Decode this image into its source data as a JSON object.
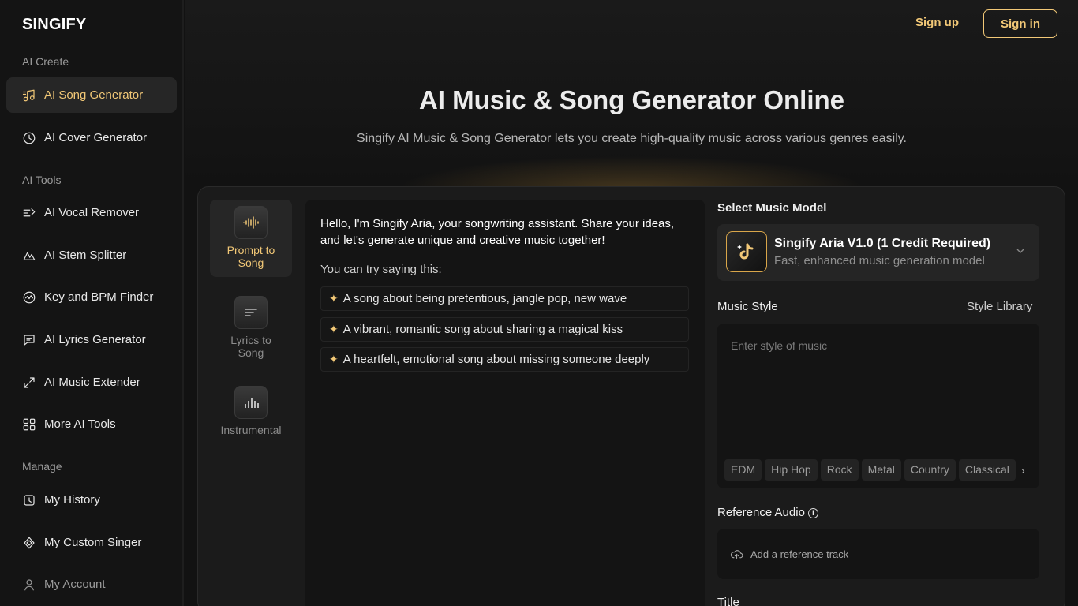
{
  "sidebar": {
    "logo": "SINGIFY",
    "sections": [
      {
        "label": "AI Create",
        "items": [
          {
            "label": "AI Song Generator",
            "icon": "music-note-icon",
            "active": true
          },
          {
            "label": "AI Cover Generator",
            "icon": "disc-icon"
          }
        ]
      },
      {
        "label": "AI Tools",
        "items": [
          {
            "label": "AI Vocal Remover",
            "icon": "vocal-split-icon"
          },
          {
            "label": "AI Stem Splitter",
            "icon": "stem-icon"
          },
          {
            "label": "Key and BPM Finder",
            "icon": "key-bpm-icon"
          },
          {
            "label": "AI Lyrics Generator",
            "icon": "lyrics-icon"
          },
          {
            "label": "AI Music Extender",
            "icon": "expand-icon"
          },
          {
            "label": "More AI Tools",
            "icon": "grid-icon"
          }
        ]
      },
      {
        "label": "Manage",
        "items": [
          {
            "label": "My History",
            "icon": "history-icon"
          },
          {
            "label": "My Custom Singer",
            "icon": "singer-icon"
          },
          {
            "label": "My Account",
            "icon": "user-icon"
          }
        ]
      }
    ]
  },
  "header": {
    "signup": "Sign up",
    "signin": "Sign in"
  },
  "hero": {
    "title": "AI Music & Song Generator Online",
    "subtitle": "Singify AI Music & Song Generator lets you create high-quality music across various genres easily."
  },
  "modes": [
    {
      "label": "Prompt to Song",
      "icon": "waveform-icon",
      "active": true
    },
    {
      "label": "Lyrics to Song",
      "icon": "lyrics-card-icon"
    },
    {
      "label": "Instrumental",
      "icon": "equalizer-icon"
    }
  ],
  "chat": {
    "intro": "Hello, I'm Singify Aria, your songwriting assistant. Share your ideas, and let's generate unique and creative music together!",
    "try_label": "You can try saying this:",
    "suggestions": [
      "A song about being pretentious, jangle pop, new wave",
      "A vibrant, romantic song about sharing a magical kiss",
      "A heartfelt, emotional song about missing someone deeply"
    ]
  },
  "model": {
    "section_label": "Select Music Model",
    "name": "Singify Aria V1.0 (1 Credit Required)",
    "description": "Fast, enhanced music generation model"
  },
  "music_style": {
    "label": "Music Style",
    "library_link": "Style Library",
    "placeholder": "Enter style of music",
    "tags": [
      "EDM",
      "Hip Hop",
      "Rock",
      "Metal",
      "Country",
      "Classical"
    ]
  },
  "reference": {
    "label": "Reference Audio",
    "add_label": "Add a reference track"
  },
  "title_section": {
    "label": "Title"
  },
  "colors": {
    "accent": "#f2c877",
    "background": "#121212",
    "panel": "#1b1b1b"
  }
}
